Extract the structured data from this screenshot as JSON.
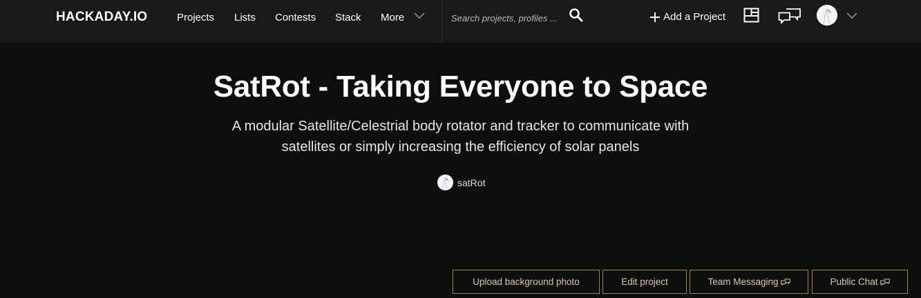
{
  "header": {
    "logo": "HACKADAY.IO",
    "nav": [
      {
        "label": "Projects"
      },
      {
        "label": "Lists"
      },
      {
        "label": "Contests"
      },
      {
        "label": "Stack"
      },
      {
        "label": "More"
      }
    ],
    "search_placeholder": "Search projects, profiles ...",
    "add_project_label": "Add a Project",
    "icons": [
      "search-icon",
      "dashboard-icon",
      "messages-icon",
      "user-avatar",
      "chevron-down-icon"
    ]
  },
  "project": {
    "title": "SatRot - Taking Everyone to Space",
    "summary": "A modular Satellite/Celestrial body rotator and tracker to communicate with satellites or simply increasing the efficiency of solar panels",
    "author": "satRot"
  },
  "actions": {
    "upload_bg": "Upload background photo",
    "edit": "Edit project",
    "team_messaging": "Team Messaging",
    "public_chat": "Public Chat"
  },
  "colors": {
    "background": "#0f0e0e",
    "topbar": "#191919",
    "button_border": "#a4894d",
    "button_text": "#d7cbb0"
  }
}
